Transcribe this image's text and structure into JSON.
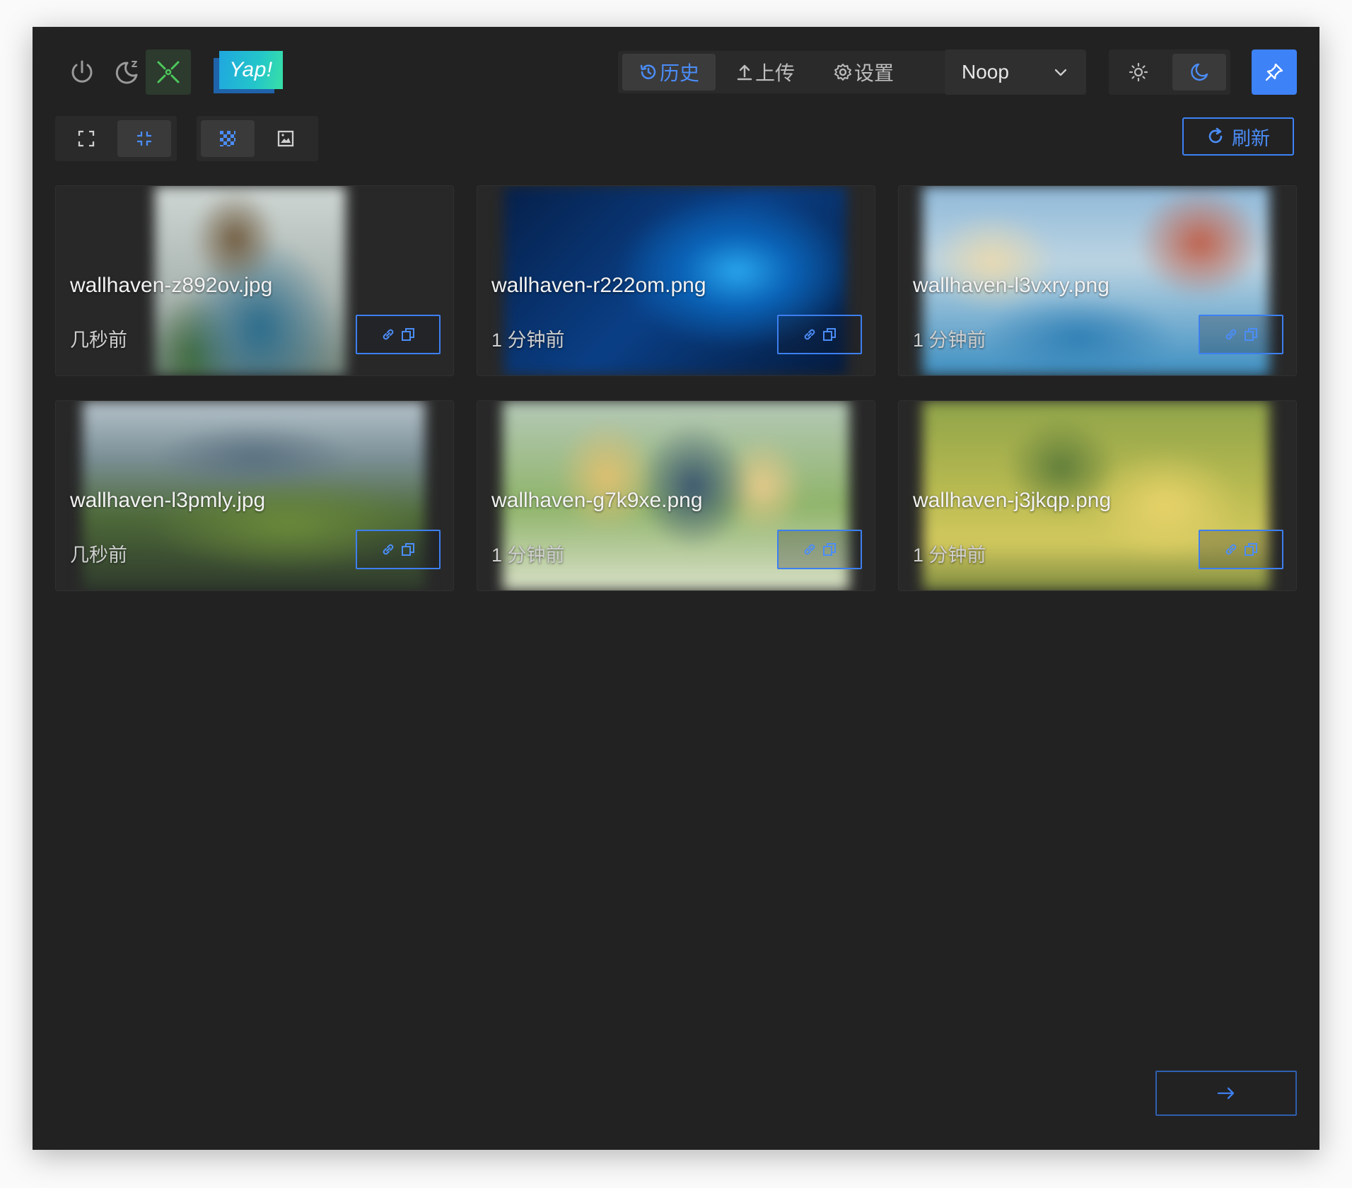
{
  "header": {
    "logo_text": "Yap!",
    "nav": {
      "history_label": "历史",
      "upload_label": "上传",
      "settings_label": "设置"
    },
    "uploader_select": {
      "value": "Noop"
    }
  },
  "toolbar": {
    "refresh_label": "刷新"
  },
  "colors": {
    "accent": "#3d82f7",
    "background": "#222222",
    "card_background": "#282828"
  },
  "images": [
    {
      "name": "wallhaven-z892ov.jpg",
      "time": "几秒前"
    },
    {
      "name": "wallhaven-r222om.png",
      "time": "1 分钟前"
    },
    {
      "name": "wallhaven-l3vxry.png",
      "time": "1 分钟前"
    },
    {
      "name": "wallhaven-l3pmly.jpg",
      "time": "几秒前"
    },
    {
      "name": "wallhaven-g7k9xe.png",
      "time": "1 分钟前"
    },
    {
      "name": "wallhaven-j3jkqp.png",
      "time": "1 分钟前"
    }
  ],
  "icons": {
    "top_left": [
      "power-icon",
      "sleep-icon",
      "focus-icon"
    ],
    "theme": [
      "sun-icon",
      "moon-icon"
    ],
    "pin": "pin-icon",
    "view_size": [
      "expand-icon",
      "compress-icon"
    ],
    "view_mode": [
      "mosaic-icon",
      "picture-icon"
    ],
    "card_actions": [
      "link-icon",
      "copy-icon"
    ],
    "pagination": "arrow-right-icon"
  }
}
